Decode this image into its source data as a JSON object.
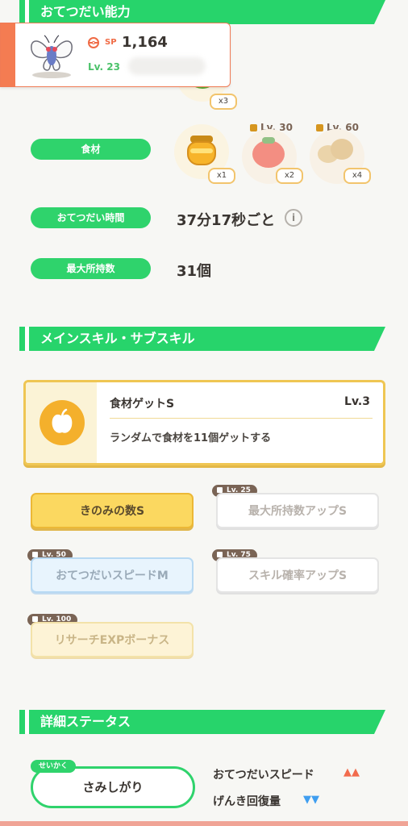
{
  "sections": {
    "helper_ability": "おてつだい能力",
    "skills": "メインスキル・サブスキル",
    "details": "詳細ステータス"
  },
  "header_card": {
    "sp_label": "SP",
    "sp_value": "1,164",
    "level": "Lv. 23"
  },
  "berries": {
    "quantity": "x3"
  },
  "ingredients": {
    "label": "食材",
    "slots": [
      {
        "name": "honey-icon",
        "quantity": "x1",
        "unlock_level": ""
      },
      {
        "name": "tomato-icon",
        "quantity": "x2",
        "unlock_level": "Lv. 30"
      },
      {
        "name": "potato-icon",
        "quantity": "x4",
        "unlock_level": "Lv. 60"
      }
    ]
  },
  "help_time": {
    "label": "おてつだい時間",
    "value": "37分17秒ごと"
  },
  "max_carry": {
    "label": "最大所持数",
    "value": "31個"
  },
  "main_skill": {
    "name": "食材ゲットS",
    "level": "Lv.3",
    "description": "ランダムで食材を11個ゲットする"
  },
  "sub_skills": [
    {
      "label": "きのみの数S",
      "unlock": ""
    },
    {
      "label": "最大所持数アップS",
      "unlock": "Lv. 25"
    },
    {
      "label": "おてつだいスピードM",
      "unlock": "Lv. 50"
    },
    {
      "label": "スキル確率アップS",
      "unlock": "Lv. 75"
    },
    {
      "label": "リサーチEXPボーナス",
      "unlock": "Lv. 100"
    }
  ],
  "nature": {
    "tag": "せいかく",
    "name": "さみしがり",
    "up_stat": "おてつだいスピード",
    "up_arrows": "▲▲",
    "down_stat": "げんき回復量",
    "down_arrows": "▼▼"
  },
  "colors": {
    "accent_green": "#27d46b",
    "gold": "#fbd860",
    "up": "#f26b4d",
    "down": "#3f9ef0"
  }
}
